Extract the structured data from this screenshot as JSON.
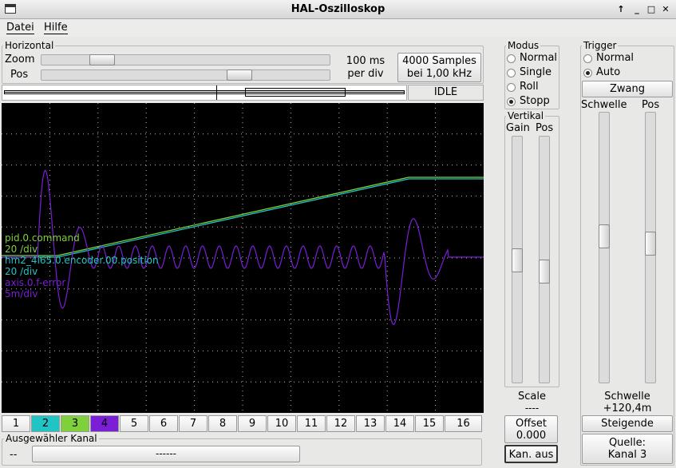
{
  "window": {
    "title": "HAL-Oszilloskop"
  },
  "menu": [
    {
      "label": "Datei",
      "key": "D"
    },
    {
      "label": "Hilfe",
      "key": "H"
    }
  ],
  "horizontal": {
    "title": "Horizontal",
    "zoom_label": "Zoom",
    "pos_label": "Pos",
    "zoom_level": 0.18,
    "pos_level": 0.7,
    "timebase_line1": "100 ms",
    "timebase_line2": "per div",
    "samples_line1": "4000 Samples",
    "samples_line2": "bei 1,00 kHz",
    "state": "IDLE"
  },
  "modus": {
    "title": "Modus",
    "options": [
      "Normal",
      "Single",
      "Roll",
      "Stopp"
    ],
    "selected": "Stopp"
  },
  "vertikal": {
    "title": "Vertikal",
    "gain_label": "Gain",
    "pos_label": "Pos",
    "gain_level": 0.5,
    "pos_level": 0.55,
    "scale_label": "Scale",
    "scale_value": "----",
    "offset_line1": "Offset",
    "offset_line2": "0.000",
    "chan_off": "Kan. aus"
  },
  "trigger": {
    "title": "Trigger",
    "options": [
      "Normal",
      "Auto"
    ],
    "selected": "Auto",
    "force_label": "Zwang",
    "schwelle_label": "Schwelle",
    "pos_label": "Pos",
    "schwelle_level": 0.45,
    "pos_level": 0.48,
    "schwelle_line1": "Schwelle",
    "schwelle_line2": "+120,4m",
    "edge": "Steigende",
    "source_line1": "Quelle:",
    "source_line2": "Kanal  3"
  },
  "traces": [
    {
      "name": "pid.0.command",
      "scale": "20 /div",
      "color": "#7fd13b"
    },
    {
      "name": "hm2_4i65.0.encoder.00.position",
      "scale": "20 /div",
      "color": "#21c4c4"
    },
    {
      "name": "axis.0.f-error",
      "scale": "5m/div",
      "color": "#7a1fd6"
    }
  ],
  "channels": [
    {
      "label": "1",
      "color": ""
    },
    {
      "label": "2",
      "color": "#21c4c4"
    },
    {
      "label": "3",
      "color": "#7fd13b"
    },
    {
      "label": "4",
      "color": "#7a1fd6"
    },
    {
      "label": "5",
      "color": ""
    },
    {
      "label": "6",
      "color": ""
    },
    {
      "label": "7",
      "color": ""
    },
    {
      "label": "8",
      "color": ""
    },
    {
      "label": "9",
      "color": ""
    },
    {
      "label": "10",
      "color": ""
    },
    {
      "label": "11",
      "color": ""
    },
    {
      "label": "12",
      "color": ""
    },
    {
      "label": "13",
      "color": ""
    },
    {
      "label": "14",
      "color": ""
    },
    {
      "label": "15",
      "color": ""
    },
    {
      "label": "16",
      "color": ""
    }
  ],
  "selected_channel": {
    "title": "Ausgewähler Kanal",
    "index": "--",
    "name": "------"
  }
}
